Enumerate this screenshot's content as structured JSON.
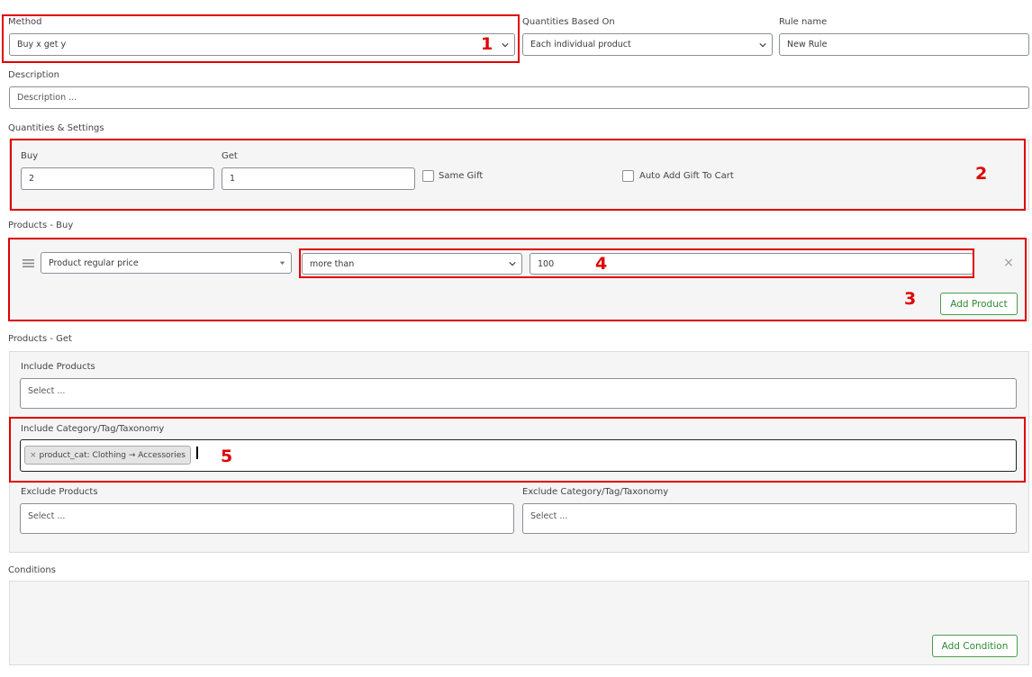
{
  "method": {
    "label": "Method",
    "value": "Buy x get y"
  },
  "quantities_based_on": {
    "label": "Quantities Based On",
    "value": "Each individual product"
  },
  "rule_name": {
    "label": "Rule name",
    "value": "New Rule"
  },
  "description": {
    "label": "Description",
    "placeholder": "Description ..."
  },
  "quantities_settings": {
    "title": "Quantities & Settings",
    "buy_label": "Buy",
    "buy_value": "2",
    "get_label": "Get",
    "get_value": "1",
    "same_gift_label": "Same Gift",
    "auto_add_label": "Auto Add Gift To Cart"
  },
  "products_buy": {
    "title": "Products - Buy",
    "condition_type": "Product regular price",
    "comparison": "more than",
    "amount": "100",
    "add_product_label": "Add Product",
    "remove_icon": "×"
  },
  "products_get": {
    "title": "Products - Get",
    "include_products_label": "Include Products",
    "include_products_placeholder": "Select ...",
    "include_category_label": "Include Category/Tag/Taxonomy",
    "include_category_tag": "product_cat: Clothing → Accessories",
    "tag_remove": "×",
    "exclude_products_label": "Exclude Products",
    "exclude_products_placeholder": "Select ...",
    "exclude_category_label": "Exclude Category/Tag/Taxonomy",
    "exclude_category_placeholder": "Select ..."
  },
  "conditions": {
    "title": "Conditions",
    "add_condition_label": "Add Condition"
  },
  "annotations": [
    "1",
    "2",
    "3",
    "4",
    "5"
  ],
  "colors": {
    "highlight": "#e00000",
    "accent_green": "#46a04a",
    "panel_bg": "#f5f5f5"
  }
}
